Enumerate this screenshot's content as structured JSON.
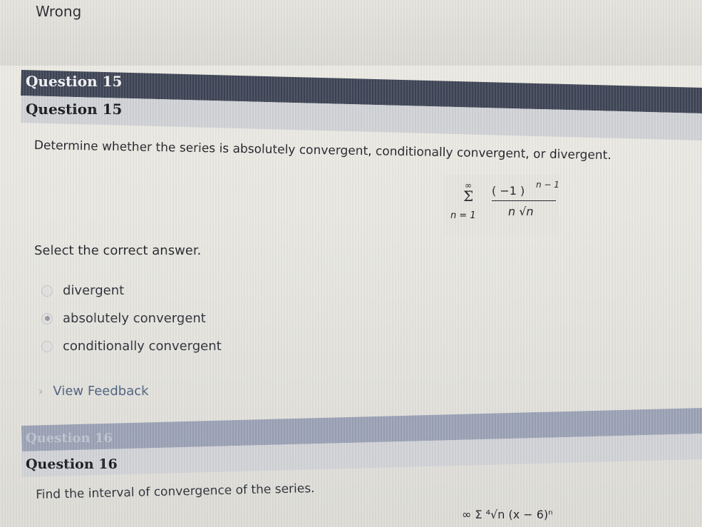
{
  "status": {
    "label": "Wrong"
  },
  "question15": {
    "header_primary": "Question 15",
    "header_secondary": "Question 15",
    "prompt": "Determine whether the series is absolutely convergent, conditionally convergent, or divergent.",
    "math": {
      "sum_upper": "∞",
      "sum_symbol": "Σ",
      "sum_lower": "n = 1",
      "numerator": "( −1 )",
      "numerator_exponent": "n − 1",
      "denominator": "n √n"
    },
    "select_label": "Select the correct answer.",
    "options": [
      {
        "label": "divergent",
        "selected": false
      },
      {
        "label": "absolutely convergent",
        "selected": true
      },
      {
        "label": "conditionally convergent",
        "selected": false
      }
    ],
    "feedback_link": "View Feedback"
  },
  "question16": {
    "header_primary": "Question 16",
    "header_secondary": "Question 16",
    "prompt": "Find the interval of convergence of the series.",
    "math_preview": "∞ Σ ⁴√n (x − 6)ⁿ"
  },
  "colors": {
    "header_band": "#3c4354",
    "subheader_band": "#cfd1d5",
    "link": "#4a5d7c",
    "radio_selected": "#95979d"
  }
}
